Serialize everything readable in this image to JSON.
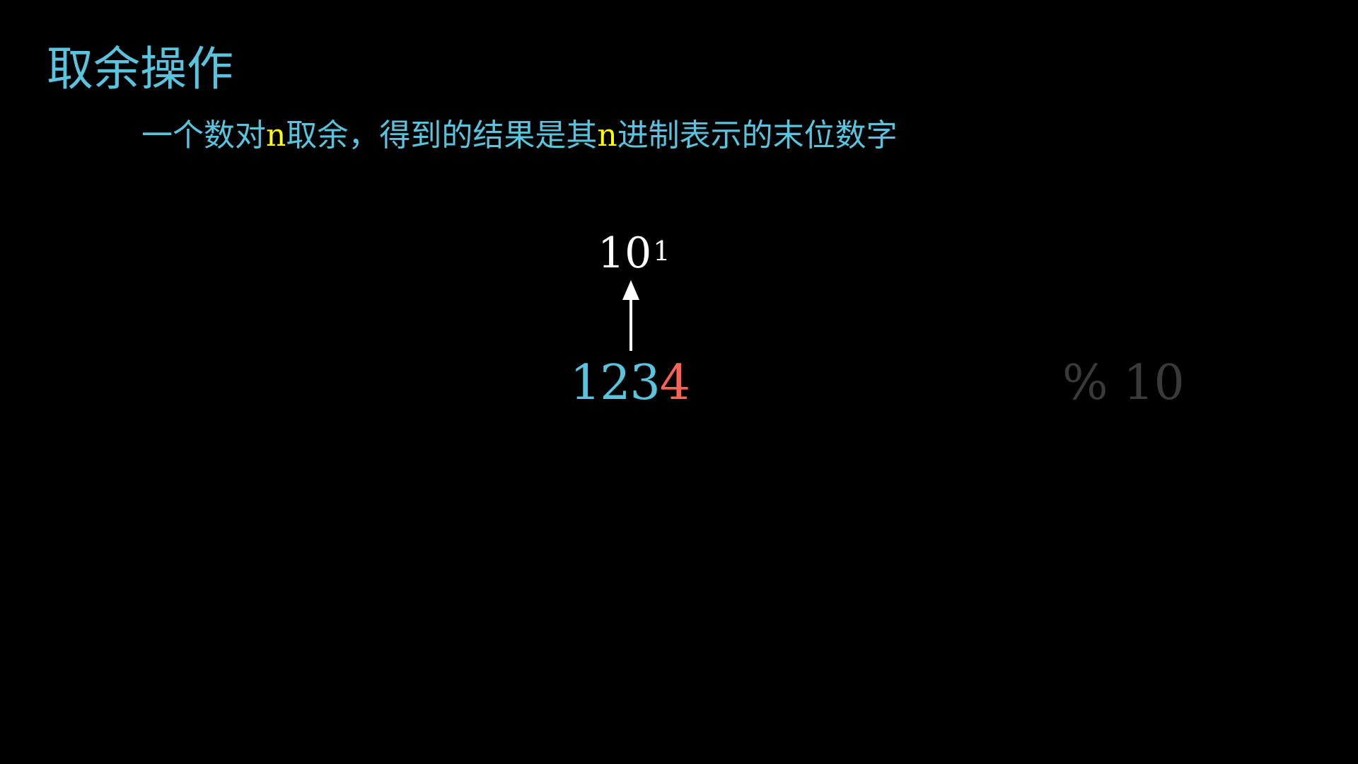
{
  "title": "取余操作",
  "subtitle": {
    "part1": "一个数对",
    "n1": "n",
    "part2": "取余，得到的结果是其",
    "n2": "n",
    "part3": "进制表示的末位数字"
  },
  "place_value": {
    "base": "10",
    "exponent": "1"
  },
  "number": {
    "leading_digits": "123",
    "last_digit": "4"
  },
  "operation": "% 10",
  "colors": {
    "background": "#000000",
    "blue": "#58c4dd",
    "yellow": "#ffff00",
    "red": "#fc6255",
    "white": "#ffffff",
    "faded": "#3a3a3a"
  }
}
